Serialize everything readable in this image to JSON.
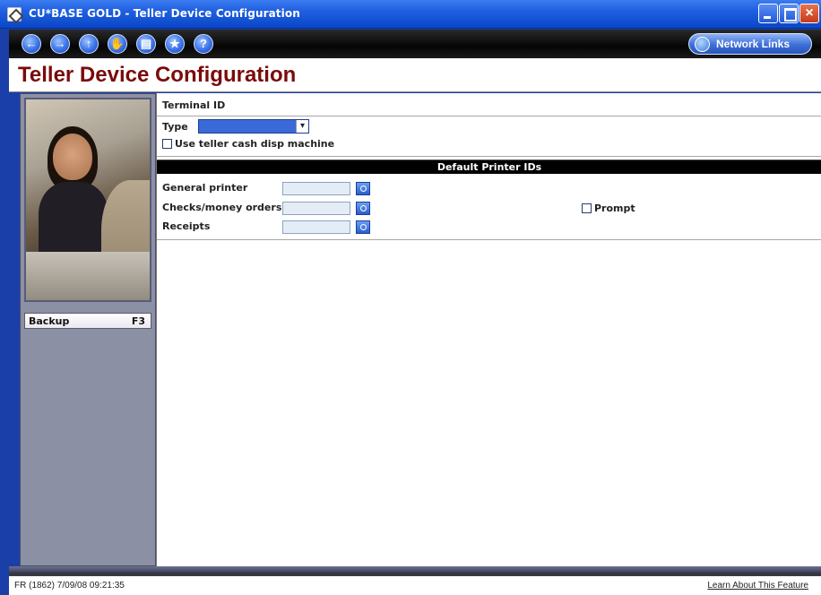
{
  "window": {
    "title": "CU*BASE GOLD - Teller Device Configuration",
    "close_glyph": "×"
  },
  "toolbar": {
    "buttons": [
      {
        "name": "back-icon",
        "glyph": "←"
      },
      {
        "name": "forward-icon",
        "glyph": "→"
      },
      {
        "name": "up-icon",
        "glyph": "↑"
      },
      {
        "name": "hand-icon",
        "glyph": "✋"
      },
      {
        "name": "print-icon",
        "glyph": "▤"
      },
      {
        "name": "star-icon",
        "glyph": "★"
      },
      {
        "name": "help-icon",
        "glyph": "?"
      }
    ],
    "network_links_label": "Network Links"
  },
  "page": {
    "title": "Teller Device Configuration"
  },
  "sidebar": {
    "backup_label": "Backup",
    "backup_key": "F3"
  },
  "form": {
    "terminal_id_label": "Terminal ID",
    "type_label": "Type",
    "type_value": "",
    "use_teller_cash_label": "Use teller cash disp machine",
    "use_teller_cash_checked": false,
    "section_title": "Default Printer IDs",
    "general_printer_label": "General printer",
    "general_printer_value": "",
    "checks_money_orders_label": "Checks/money orders",
    "checks_money_orders_value": "",
    "receipts_label": "Receipts",
    "receipts_value": "",
    "prompt_label": "Prompt",
    "prompt_checked": false
  },
  "status": {
    "left_text": "FR (1862) 7/09/08 09:21:35",
    "right_link": "Learn About This Feature"
  },
  "colors": {
    "title_accent": "#7a0b0b",
    "titlebar_blue": "#0a47c8",
    "panel_gray": "#8c90a4"
  }
}
